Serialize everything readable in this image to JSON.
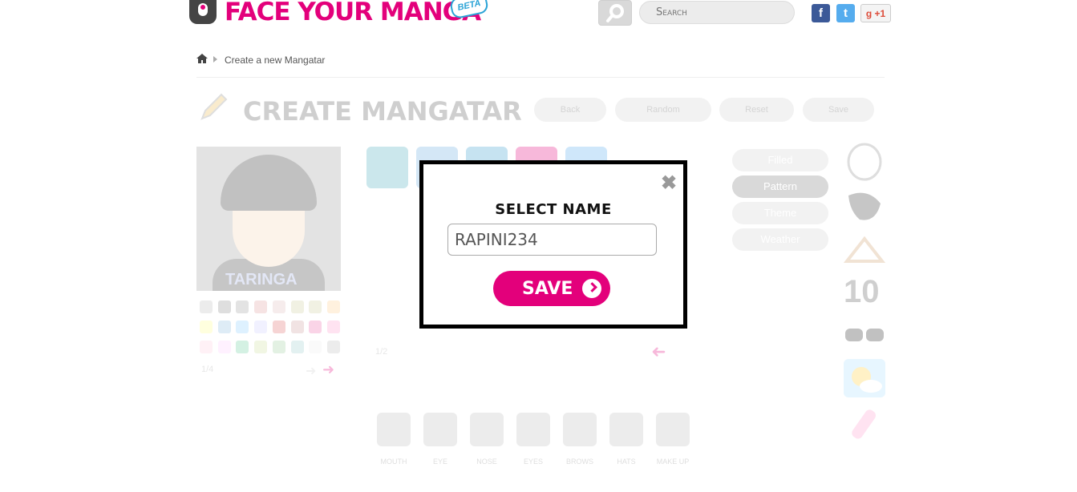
{
  "header": {
    "logo_text": "FACE YOUR MANGA",
    "beta_badge": "BETA",
    "search_placeholder": "Search",
    "social": {
      "facebook": "f",
      "twitter": "t",
      "gplus": "g +1"
    }
  },
  "breadcrumb": {
    "current": "Create a new Mangatar"
  },
  "page": {
    "title": "CREATE MANGATAR",
    "toolbar": [
      "Back",
      "Random",
      "Reset",
      "Save"
    ],
    "avatar_brand": "TARINGA",
    "swatch_pager": "1/4",
    "item_pager": "1/2",
    "options": [
      {
        "label": "Filled",
        "active": false
      },
      {
        "label": "Pattern",
        "active": true
      },
      {
        "label": "Theme",
        "active": false
      },
      {
        "label": "Weather",
        "active": false
      }
    ],
    "side_tools": [
      "head-icon",
      "hair-icon",
      "hanger-icon",
      "number-icon",
      "glasses-icon",
      "weather-icon",
      "makeup-icon"
    ],
    "categories": [
      "MOUTH",
      "EYE",
      "NOSE",
      "EYES",
      "BROWS",
      "HATS",
      "MAKE UP"
    ],
    "swatch_colors": [
      "#eee",
      "#bbb",
      "#888",
      "#999",
      "#d99",
      "#dbb",
      "#cc9",
      "#cc9",
      "#fc8",
      "#ff8",
      "#8bd",
      "#8cf",
      "#ccf",
      "#d66",
      "#c99",
      "#e6a",
      "#f9c",
      "#fcd",
      "#fcf",
      "#6c9",
      "#cd9",
      "#9c9",
      "#9cc"
    ]
  },
  "modal": {
    "title": "SELECT NAME",
    "name_value": "RAPINI234",
    "save_label": "SAVE",
    "close_glyph": "✖"
  },
  "colors": {
    "brand": "#e3007b",
    "accent": "#2aa3d6"
  }
}
